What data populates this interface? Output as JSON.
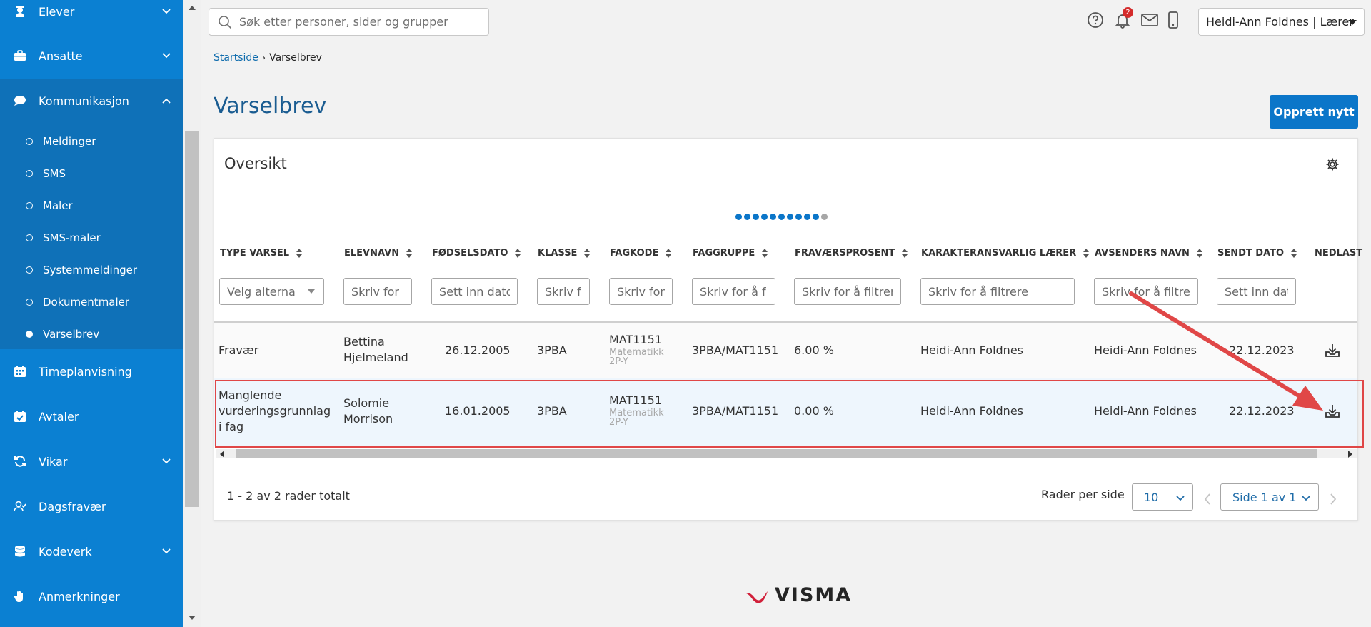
{
  "sidebar": {
    "items": [
      {
        "label": "Elever",
        "icon": "graduation-icon"
      },
      {
        "label": "Ansatte",
        "icon": "briefcase-icon"
      },
      {
        "label": "Kommunikasjon",
        "icon": "chat-icon"
      },
      {
        "label": "Timeplanvisning",
        "icon": "calendar-icon"
      },
      {
        "label": "Avtaler",
        "icon": "calendar-check-icon"
      },
      {
        "label": "Vikar",
        "icon": "refresh-icon"
      },
      {
        "label": "Dagsfravær",
        "icon": "user-check-icon"
      },
      {
        "label": "Kodeverk",
        "icon": "database-icon"
      },
      {
        "label": "Anmerkninger",
        "icon": "hand-icon"
      }
    ],
    "sub_items": [
      {
        "label": "Meldinger"
      },
      {
        "label": "SMS"
      },
      {
        "label": "Maler"
      },
      {
        "label": "SMS-maler"
      },
      {
        "label": "Systemmeldinger"
      },
      {
        "label": "Dokumentmaler"
      },
      {
        "label": "Varselbrev"
      }
    ]
  },
  "topbar": {
    "search_placeholder": "Søk etter personer, sider og grupper",
    "notification_count": "2",
    "user_label": "Heidi-Ann Foldnes | Lærer"
  },
  "breadcrumb": {
    "home": "Startside",
    "current": "Varselbrev"
  },
  "page": {
    "title": "Varselbrev",
    "create_button": "Opprett nytt"
  },
  "overview": {
    "title": "Oversikt",
    "columns": [
      "TYPE VARSEL",
      "ELEVNAVN",
      "FØDSELSDATO",
      "KLASSE",
      "FAGKODE",
      "FAGGRUPPE",
      "FRAVÆRSPROSENT",
      "KARAKTERANSVARLIG LÆRER",
      "AVSENDERS NAVN",
      "SENDT DATO",
      "NEDLAST"
    ],
    "filters": {
      "type": "Velg alterna",
      "elevnavn": "Skriv for",
      "fodselsdato": "Sett inn dato",
      "klasse": "Skriv f",
      "fagkode": "Skriv for",
      "faggruppe": "Skriv for å f",
      "fravaer": "Skriv for å filtrer",
      "larer": "Skriv for å filtrere",
      "avsender": "Skriv for å filtre",
      "sendt": "Sett inn dat"
    },
    "rows": [
      {
        "type_line1": "Fravær",
        "type_line2": "",
        "type_line3": "",
        "name_line1": "Bettina",
        "name_line2": "Hjelmeland",
        "dob": "26.12.2005",
        "class": "3PBA",
        "fagkode": "MAT1151",
        "fag_sub1": "Matematikk",
        "fag_sub2": "2P-Y",
        "faggruppe": "3PBA/MAT1151",
        "fravaer": "6.00 %",
        "larer": "Heidi-Ann Foldnes",
        "avsender": "Heidi-Ann Foldnes",
        "sendt": "22.12.2023"
      },
      {
        "type_line1": "Manglende",
        "type_line2": "vurderingsgrunnlag",
        "type_line3": "i fag",
        "name_line1": "Solomie",
        "name_line2": "Morrison",
        "dob": "16.01.2005",
        "class": "3PBA",
        "fagkode": "MAT1151",
        "fag_sub1": "Matematikk",
        "fag_sub2": "2P-Y",
        "faggruppe": "3PBA/MAT1151",
        "fravaer": "0.00 %",
        "larer": "Heidi-Ann Foldnes",
        "avsender": "Heidi-Ann Foldnes",
        "sendt": "22.12.2023"
      }
    ],
    "total_text": "1 - 2 av 2 rader totalt",
    "rows_per_page_label": "Rader per side",
    "rows_per_page_value": "10",
    "page_select_value": "Side 1 av 1"
  },
  "footer": {
    "logo_text": "VISMA"
  },
  "colors": {
    "accent": "#0b80d2",
    "highlight": "#e04747",
    "title": "#1a5c91"
  }
}
